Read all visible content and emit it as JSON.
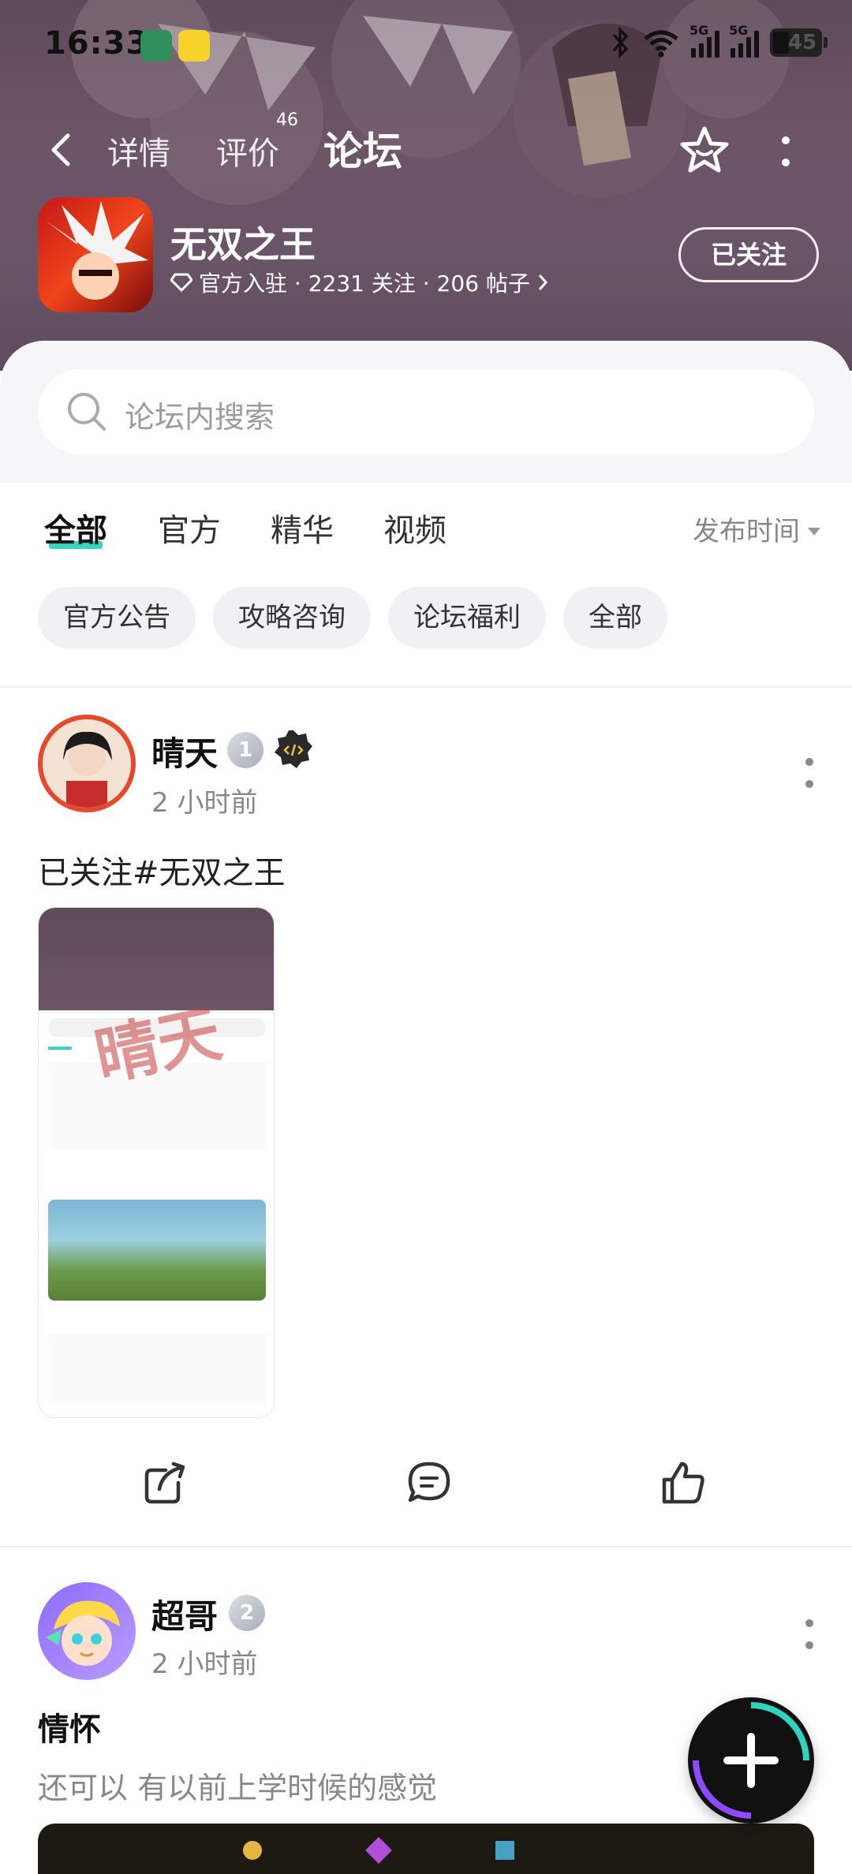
{
  "status_bar": {
    "time": "16:33",
    "battery": "45"
  },
  "nav": {
    "tabs": [
      {
        "label": "详情"
      },
      {
        "label": "评价"
      },
      {
        "label": "论坛"
      }
    ],
    "review_count": "46"
  },
  "game": {
    "name": "无双之王",
    "meta": "官方入驻 · 2231 关注 · 206 帖子",
    "follow_label": "已关注"
  },
  "search": {
    "placeholder": "论坛内搜索"
  },
  "filter": {
    "tabs": [
      "全部",
      "官方",
      "精华",
      "视频"
    ],
    "sort_label": "发布时间"
  },
  "chips": [
    "官方公告",
    "攻略咨询",
    "论坛福利",
    "全部"
  ],
  "posts": [
    {
      "username": "晴天",
      "level": "1",
      "time": "2 小时前",
      "text": "已关注#无双之王",
      "image_watermark": "晴天"
    },
    {
      "username": "超哥",
      "level": "2",
      "time": "2 小时前",
      "title": "情怀",
      "text": "还可以 有以前上学时候的感觉"
    }
  ],
  "colors": {
    "accent": "#36d6c0",
    "header": "#6a5467"
  }
}
